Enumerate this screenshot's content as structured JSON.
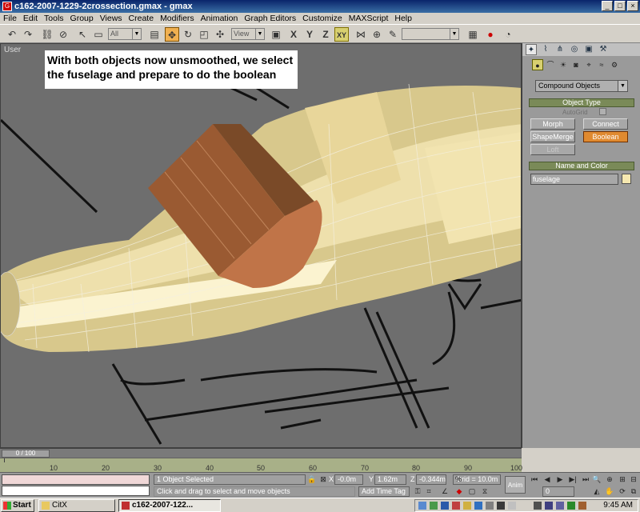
{
  "window": {
    "title": "c162-2007-1229-2crossection.gmax - gmax",
    "min": "_",
    "max": "□",
    "close": "×"
  },
  "menu": [
    "File",
    "Edit",
    "Tools",
    "Group",
    "Views",
    "Create",
    "Modifiers",
    "Animation",
    "Graph Editors",
    "Customize",
    "MAXScript",
    "Help"
  ],
  "toolbar": {
    "selection_filter": "All",
    "ref_coord": "View",
    "axis_constraint": "XY"
  },
  "viewport": {
    "label": "User",
    "caption": "With both objects now unsmoothed, we select the fuselage and prepare to do the boolean"
  },
  "command_panel": {
    "category": "Compound Objects",
    "object_type_title": "Object Type",
    "autogrid_label": "AutoGrid",
    "buttons": [
      "Morph",
      "Connect",
      "ShapeMerge",
      "Boolean",
      "Loft"
    ],
    "active_button": "Boolean",
    "name_color_title": "Name and Color",
    "object_name": "fuselage",
    "object_color": "#f6e8b0"
  },
  "timeline": {
    "frame_display": "0 / 100",
    "ticks": [
      "10",
      "20",
      "30",
      "40",
      "50",
      "60",
      "70",
      "80",
      "90",
      "100"
    ]
  },
  "status": {
    "selection": "1 Object Selected",
    "prompt": "Click and drag to select and move objects",
    "x_label": "X",
    "x_value": "-0.0m",
    "y_label": "Y",
    "y_value": "1.62m",
    "z_label": "Z",
    "z_value": "-0.344m",
    "grid": "Grid = 10.0m",
    "add_time_tag": "Add Time Tag",
    "anim": "Anim",
    "frame": "0"
  },
  "taskbar": {
    "start": "Start",
    "items": [
      "CitX",
      "c162-2007-122..."
    ],
    "clock": "9:45 AM"
  }
}
